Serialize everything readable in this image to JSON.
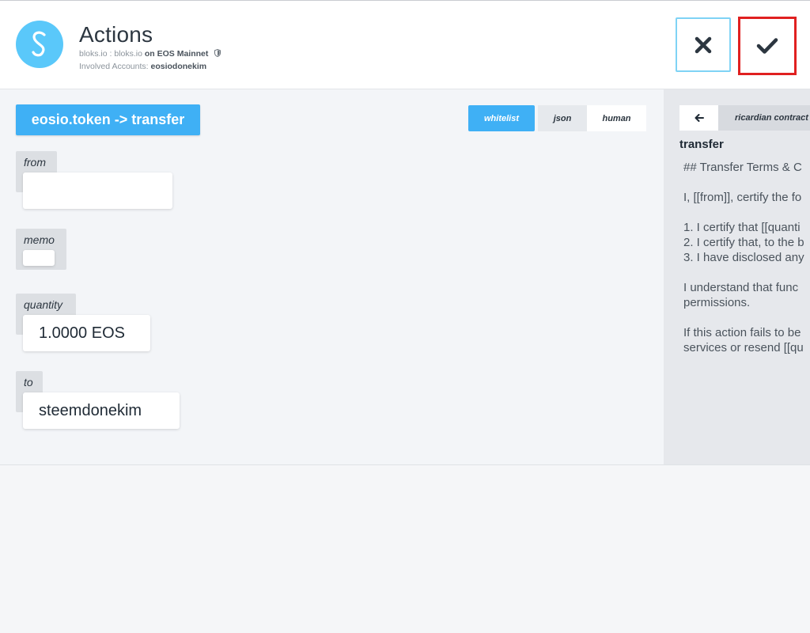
{
  "header": {
    "title": "Actions",
    "source_prefix": "bloks.io : bloks.io",
    "network": "on EOS Mainnet",
    "accounts_label": "Involved Accounts:",
    "accounts_value": "eosiodonekim",
    "cancel_icon": "close-icon",
    "confirm_icon": "checkmark-icon"
  },
  "action": {
    "name": "eosio.token -> transfer"
  },
  "view_tabs": [
    {
      "label": "whitelist",
      "active": true
    },
    {
      "label": "json",
      "active": false
    },
    {
      "label": "human",
      "active": false
    }
  ],
  "fields": [
    {
      "label": "from",
      "value": ""
    },
    {
      "label": "memo",
      "value": ""
    },
    {
      "label": "quantity",
      "value": "1.0000 EOS"
    },
    {
      "label": "to",
      "value": "steemdonekim"
    }
  ],
  "contract": {
    "back_icon": "arrow-left-icon",
    "tab_label": "ricardian contract",
    "title": "transfer",
    "lines": [
      "## Transfer Terms & C",
      "I, [[from]], certify the fo",
      "1. I certify that [[quanti",
      "2. I certify that, to the b",
      "3. I have disclosed any",
      "I understand that func",
      "permissions.",
      "If this action fails to be",
      "services or resend [[qu"
    ]
  },
  "colors": {
    "accent": "#3fb0f5",
    "logo": "#5ac8fa",
    "confirm_border": "#e02020",
    "cancel_border": "#7fd3f5"
  }
}
